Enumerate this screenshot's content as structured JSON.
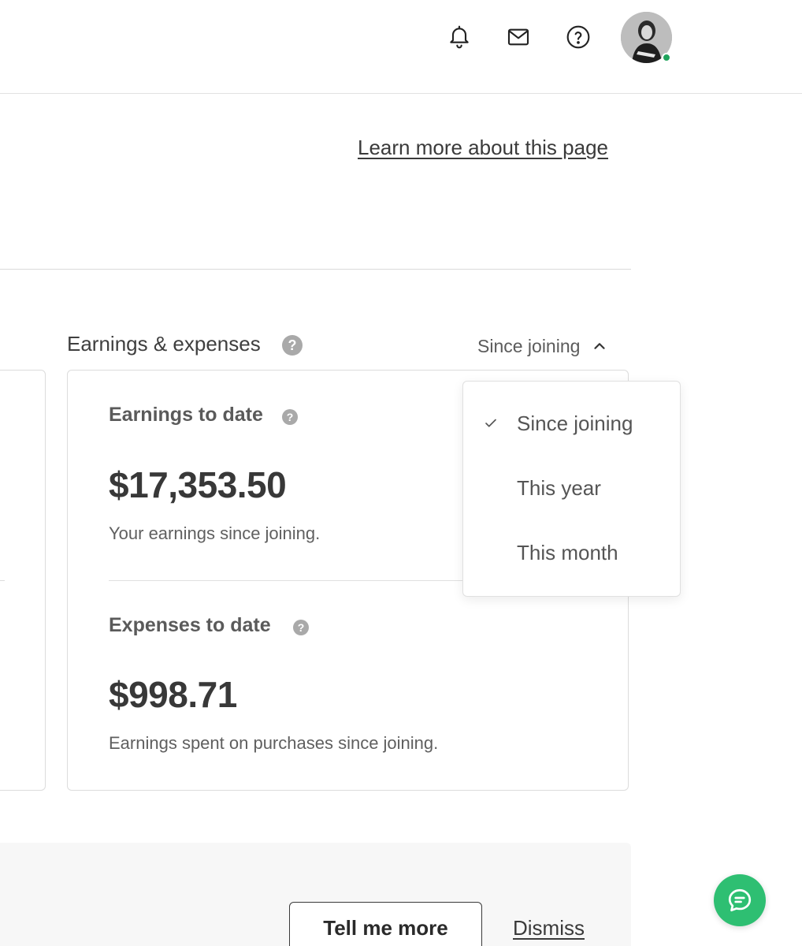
{
  "header": {
    "icons": [
      "bell-icon",
      "mail-icon",
      "help-icon",
      "avatar"
    ],
    "presence_color": "#1fa35c"
  },
  "page": {
    "learn_more": "Learn more about this page"
  },
  "earnings": {
    "title": "Earnings & expenses",
    "period_selected": "Since joining",
    "earnings_label": "Earnings to date",
    "earnings_value": "$17,353.50",
    "earnings_desc": "Your earnings since joining.",
    "expenses_label": "Expenses to date",
    "expenses_value": "$998.71",
    "expenses_desc": "Earnings spent on purchases since joining."
  },
  "dropdown": {
    "items": [
      {
        "label": "Since joining",
        "selected": true
      },
      {
        "label": "This year",
        "selected": false
      },
      {
        "label": "This month",
        "selected": false
      }
    ]
  },
  "banner": {
    "tell_me_more": "Tell me more",
    "dismiss": "Dismiss"
  },
  "colors": {
    "accent": "#2ebf72",
    "text": "#3c3c3c"
  }
}
